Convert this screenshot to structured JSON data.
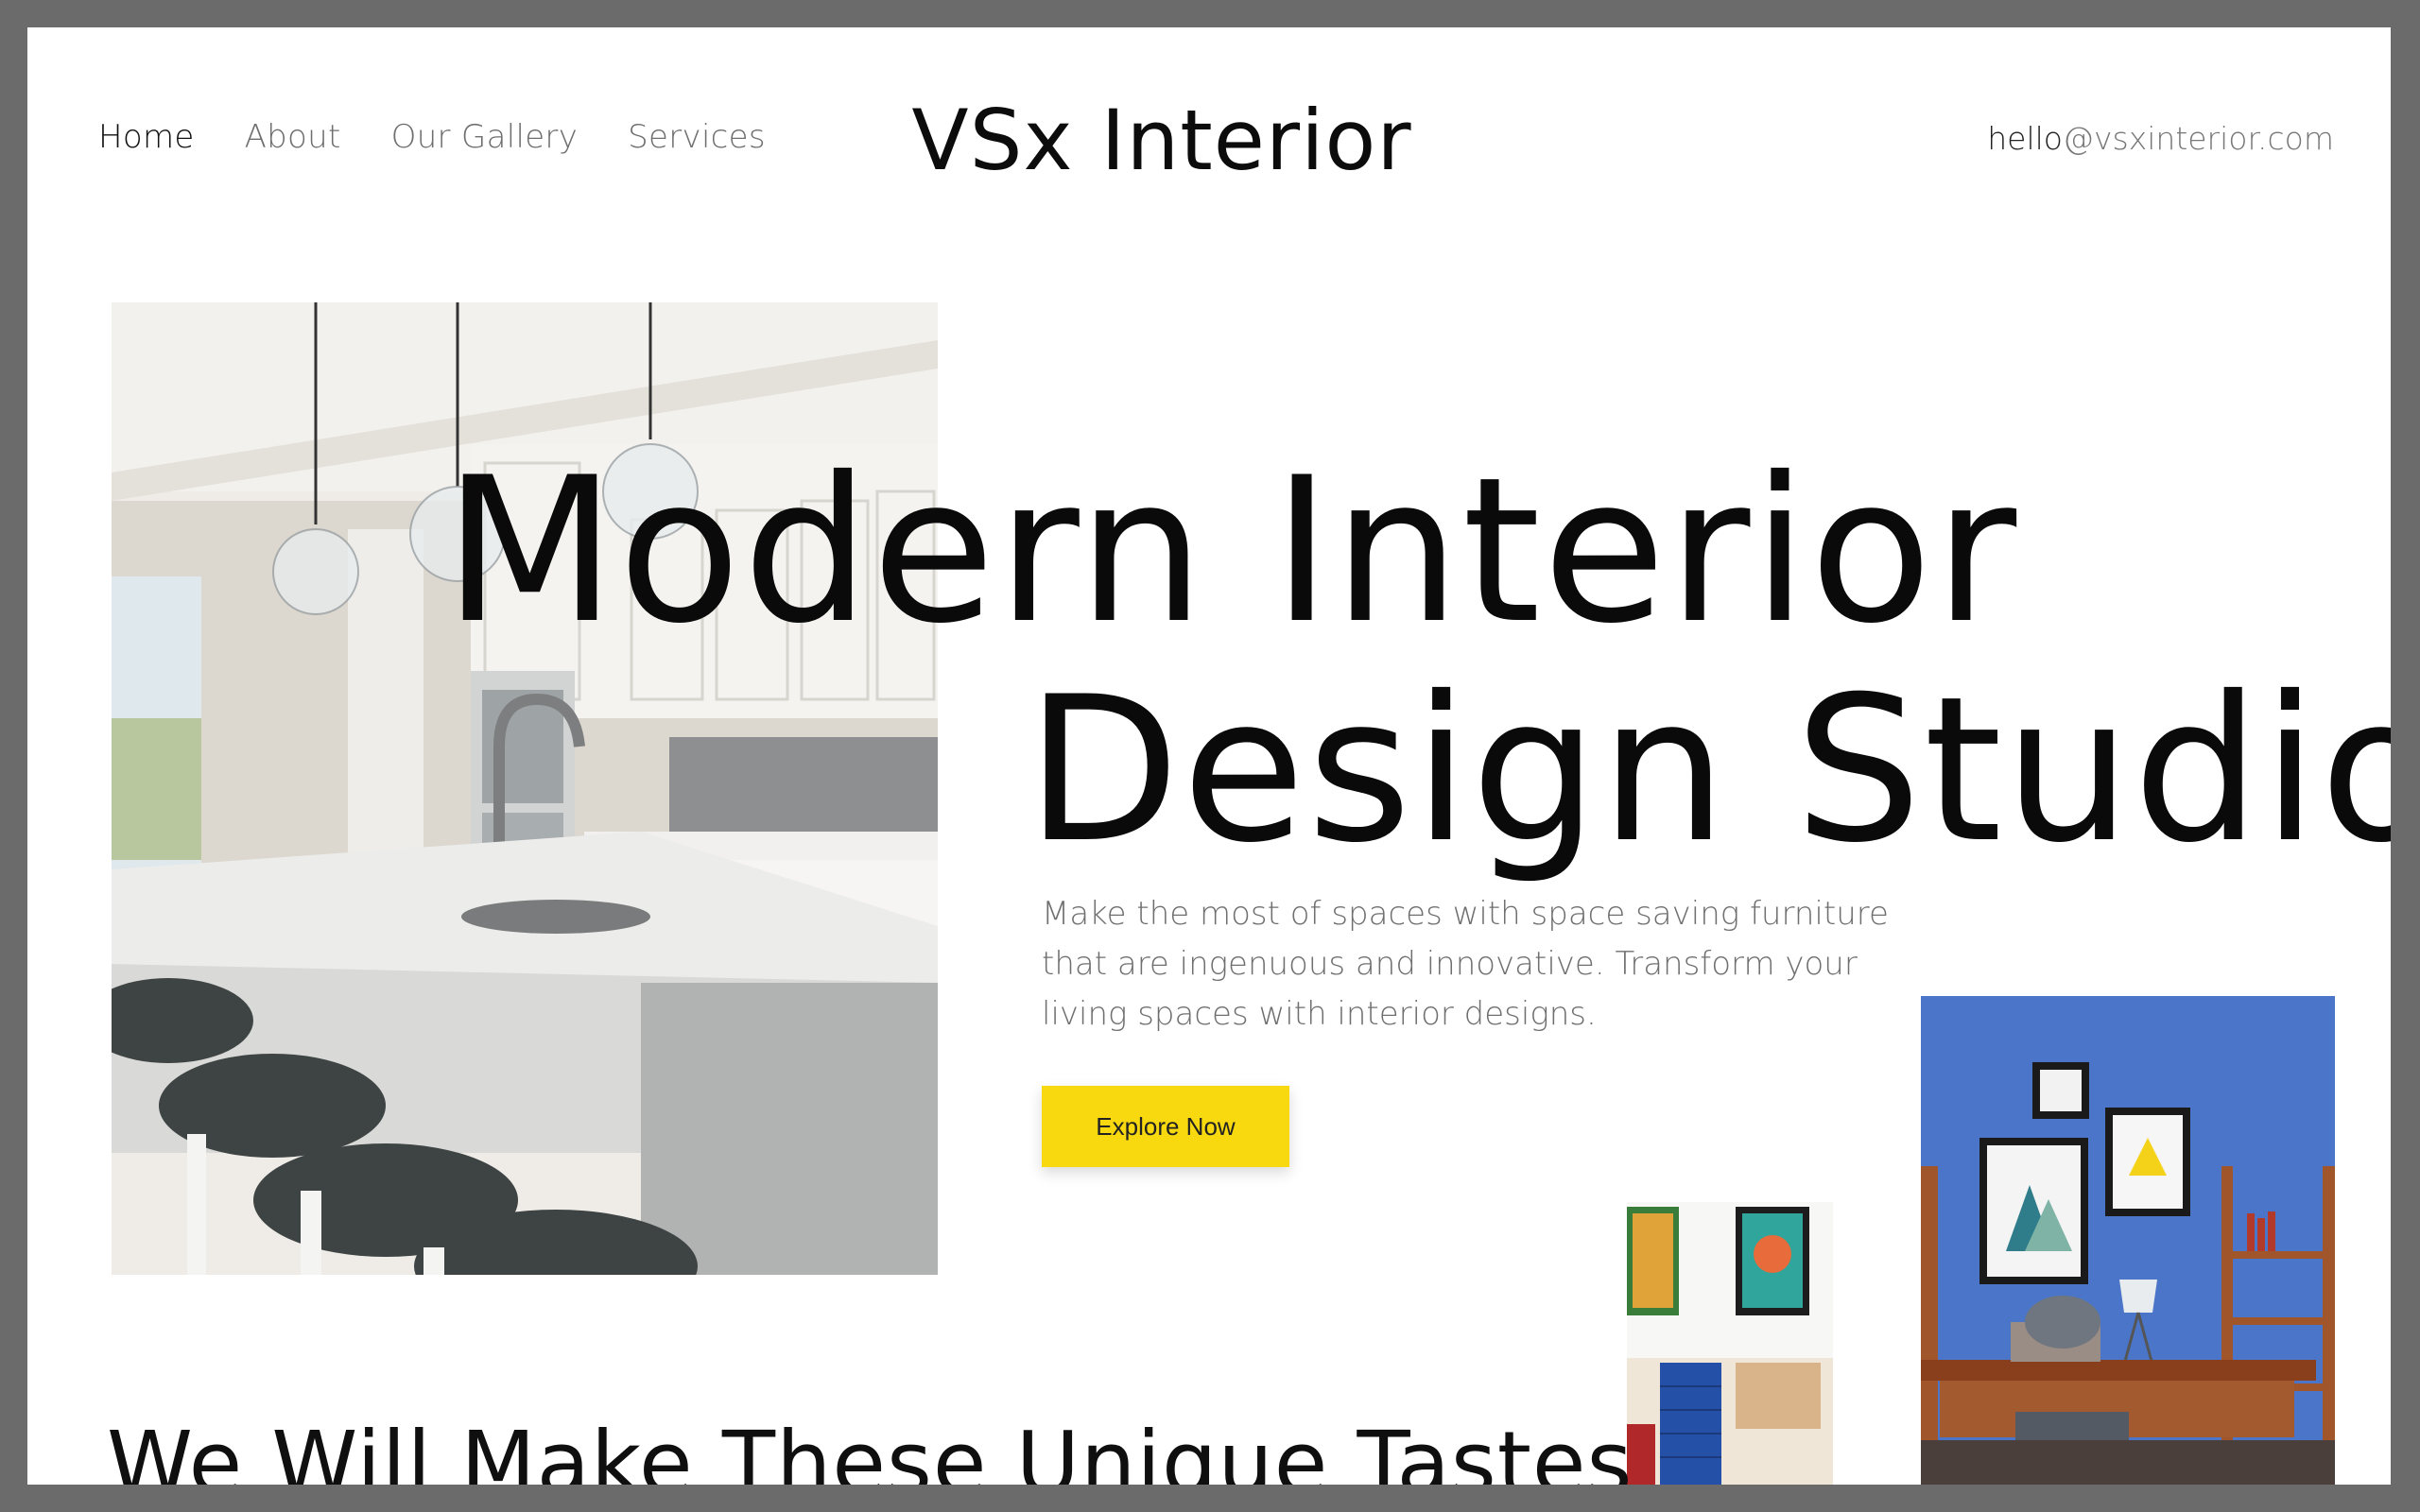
{
  "header": {
    "nav": [
      {
        "label": "Home",
        "active": true
      },
      {
        "label": "About",
        "active": false
      },
      {
        "label": "Our Gallery",
        "active": false
      },
      {
        "label": "Services",
        "active": false
      }
    ],
    "logo": "VSx Interior",
    "email_lead": "hello",
    "email_rest": "@vsxinterior.com"
  },
  "hero": {
    "title_line1": "Modern Interior",
    "title_line2": "Design Studio",
    "description": "Make the most of spaces with space saving furniture that are ingenuous and innovative. Transform your living spaces with interior designs.",
    "cta_label": "Explore Now"
  },
  "section": {
    "heading": "We Will Make These Unique Tastes"
  },
  "colors": {
    "accent": "#f8d90f",
    "frame": "#6b6b6b",
    "wall_blue": "#4a75c8"
  }
}
